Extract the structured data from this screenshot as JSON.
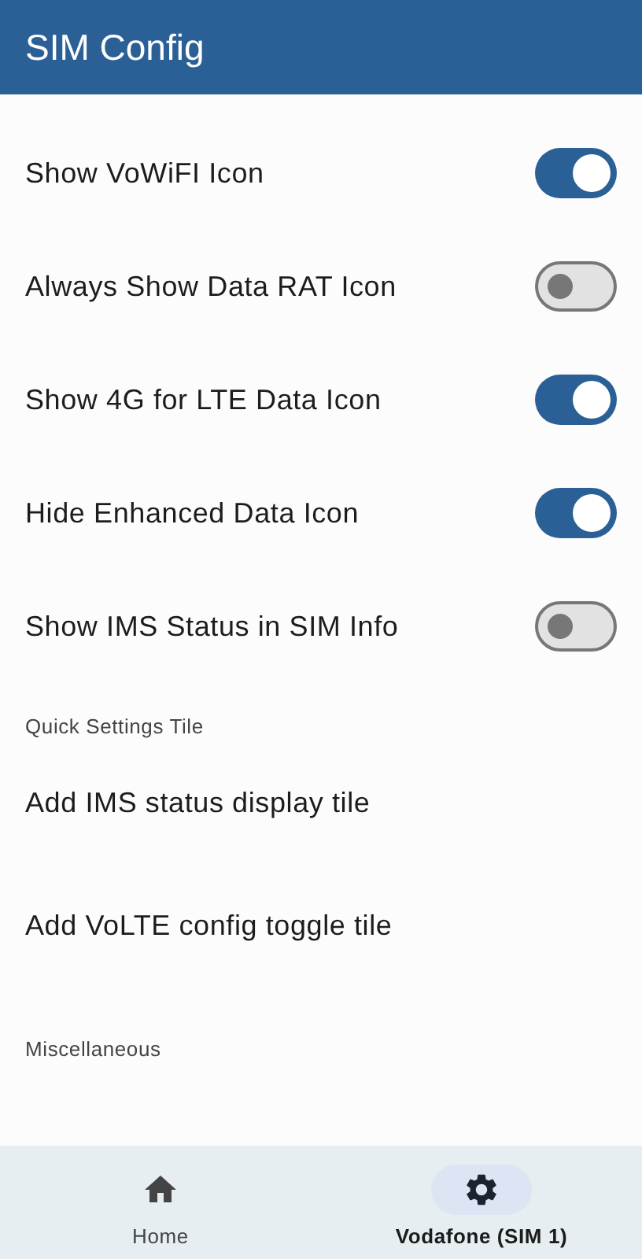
{
  "app_bar": {
    "title": "SIM Config"
  },
  "toggles": [
    {
      "label": "Show VoWiFI Icon",
      "on": true
    },
    {
      "label": "Always Show Data RAT Icon",
      "on": false
    },
    {
      "label": "Show 4G for LTE Data Icon",
      "on": true
    },
    {
      "label": "Hide Enhanced Data Icon",
      "on": true
    },
    {
      "label": "Show IMS Status in SIM Info",
      "on": false
    }
  ],
  "sections": [
    {
      "header": "Quick Settings Tile",
      "items": [
        "Add IMS status display tile",
        "Add VoLTE config toggle tile"
      ]
    },
    {
      "header": "Miscellaneous"
    }
  ],
  "bottom_nav": [
    {
      "kind": "home",
      "label": "Home",
      "selected": false
    },
    {
      "kind": "settings",
      "label": "Vodafone (SIM 1)",
      "selected": true
    }
  ]
}
